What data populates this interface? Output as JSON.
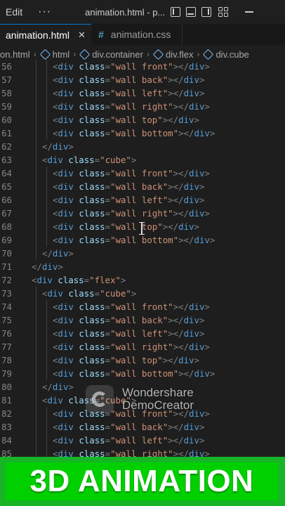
{
  "titlebar": {
    "menu_edit": "Edit",
    "menu_more": "···",
    "window_title": "animation.html - p..."
  },
  "tabs": [
    {
      "label": "animation.html",
      "close": "✕",
      "active": true
    },
    {
      "label": "animation.css",
      "icon": "#",
      "active": false
    }
  ],
  "breadcrumbs": [
    {
      "label": "on.html",
      "icon": ""
    },
    {
      "label": "html",
      "icon": "cube-icon"
    },
    {
      "label": "div.container",
      "icon": "cube-icon"
    },
    {
      "label": "div.flex",
      "icon": "cube-icon"
    },
    {
      "label": "div.cube",
      "icon": "cube-icon"
    }
  ],
  "breadcrumb_separator": "›",
  "code_lines": [
    {
      "n": "56",
      "indent": 3,
      "text": "<div class=\"wall front\"></div>"
    },
    {
      "n": "57",
      "indent": 3,
      "text": "<div class=\"wall back\"></div>"
    },
    {
      "n": "58",
      "indent": 3,
      "text": "<div class=\"wall left\"></div>"
    },
    {
      "n": "59",
      "indent": 3,
      "text": "<div class=\"wall right\"></div>"
    },
    {
      "n": "60",
      "indent": 3,
      "text": "<div class=\"wall top\"></div>"
    },
    {
      "n": "61",
      "indent": 3,
      "text": "<div class=\"wall bottom\"></div>"
    },
    {
      "n": "62",
      "indent": 2,
      "text": "</div>"
    },
    {
      "n": "63",
      "indent": 2,
      "text": "<div class=\"cube\">"
    },
    {
      "n": "64",
      "indent": 3,
      "text": "<div class=\"wall front\"></div>"
    },
    {
      "n": "65",
      "indent": 3,
      "text": "<div class=\"wall back\"></div>"
    },
    {
      "n": "66",
      "indent": 3,
      "text": "<div class=\"wall left\"></div>"
    },
    {
      "n": "67",
      "indent": 3,
      "text": "<div class=\"wall right\"></div>"
    },
    {
      "n": "68",
      "indent": 3,
      "text": "<div class=\"wall top\"></div>"
    },
    {
      "n": "69",
      "indent": 3,
      "text": "<div class=\"wall bottom\"></div>"
    },
    {
      "n": "70",
      "indent": 2,
      "text": "</div>"
    },
    {
      "n": "71",
      "indent": 1,
      "text": "</div>"
    },
    {
      "n": "72",
      "indent": 1,
      "text": "<div class=\"flex\">"
    },
    {
      "n": "73",
      "indent": 2,
      "text": "<div class=\"cube\">"
    },
    {
      "n": "74",
      "indent": 3,
      "text": "<div class=\"wall front\"></div>"
    },
    {
      "n": "75",
      "indent": 3,
      "text": "<div class=\"wall back\"></div>"
    },
    {
      "n": "76",
      "indent": 3,
      "text": "<div class=\"wall left\"></div>"
    },
    {
      "n": "77",
      "indent": 3,
      "text": "<div class=\"wall right\"></div>"
    },
    {
      "n": "78",
      "indent": 3,
      "text": "<div class=\"wall top\"></div>"
    },
    {
      "n": "79",
      "indent": 3,
      "text": "<div class=\"wall bottom\"></div>"
    },
    {
      "n": "80",
      "indent": 2,
      "text": "</div>"
    },
    {
      "n": "81",
      "indent": 2,
      "text": "<div class=\"cube\">"
    },
    {
      "n": "82",
      "indent": 3,
      "text": "<div class=\"wall front\"></div>"
    },
    {
      "n": "83",
      "indent": 3,
      "text": "<div class=\"wall back\"></div>"
    },
    {
      "n": "84",
      "indent": 3,
      "text": "<div class=\"wall left\"></div>"
    },
    {
      "n": "85",
      "indent": 3,
      "text": "<div class=\"wall right\"></div>"
    }
  ],
  "watermark": {
    "line1": "Wondershare",
    "line2": "DemoCreator"
  },
  "banner": {
    "text": "3D ANIMATION"
  },
  "colors": {
    "editor_bg": "#1e1e1e",
    "tag": "#569cd6",
    "attribute": "#9cdcfe",
    "string": "#ce9178",
    "punctuation": "#808080",
    "line_number": "#858585",
    "banner_green": "#00d000"
  }
}
